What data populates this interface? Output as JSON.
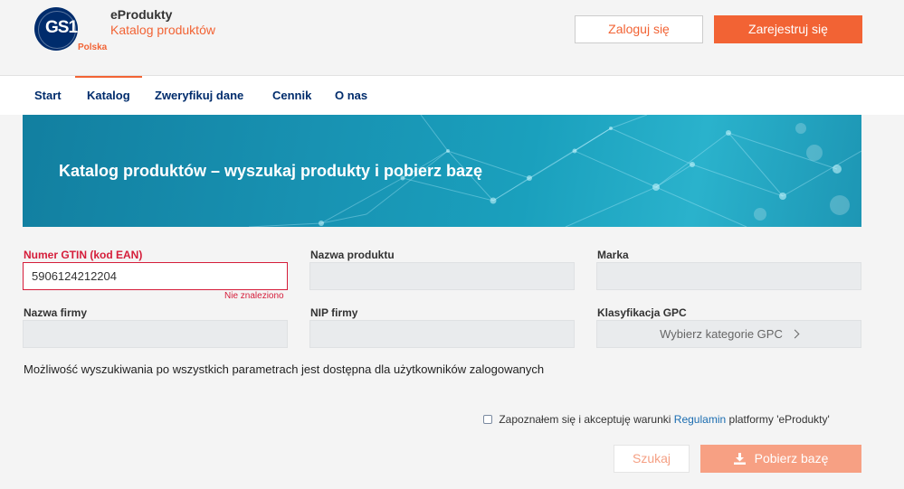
{
  "brand": {
    "logo_text": "GS1",
    "country": "Polska",
    "app_name": "eProdukty",
    "app_subtitle": "Katalog produktów"
  },
  "header": {
    "login_label": "Zaloguj się",
    "register_label": "Zarejestruj się"
  },
  "nav": {
    "items": [
      {
        "label": "Start",
        "active": false
      },
      {
        "label": "Katalog",
        "active": true
      },
      {
        "label": "Zweryfikuj dane",
        "active": false
      },
      {
        "label": "Cennik",
        "active": false
      },
      {
        "label": "O nas",
        "active": false
      }
    ]
  },
  "banner": {
    "title": "Katalog produktów – wyszukaj produkty i pobierz bazę"
  },
  "form": {
    "gtin": {
      "label": "Numer GTIN (kod EAN)",
      "value": "5906124212204",
      "error": "Nie znaleziono"
    },
    "product_name": {
      "label": "Nazwa produktu",
      "value": ""
    },
    "brand": {
      "label": "Marka",
      "value": ""
    },
    "company_name": {
      "label": "Nazwa firmy",
      "value": ""
    },
    "nip": {
      "label": "NIP firmy",
      "value": ""
    },
    "gpc": {
      "label": "Klasyfikacja GPC",
      "button_label": "Wybierz kategorie GPC"
    }
  },
  "info_text": "Możliwość wyszukiwania po wszystkich parametrach jest dostępna dla użytkowników zalogowanych",
  "terms": {
    "checked": false,
    "text_before": "Zapoznałem się i akceptuję warunki",
    "link_label": "Regulamin",
    "text_after": "platformy 'eProdukty'"
  },
  "actions": {
    "search_label": "Szukaj",
    "download_label": "Pobierz bazę"
  },
  "colors": {
    "accent": "#f26334",
    "navy": "#002c6c",
    "error": "#d51d3a",
    "link": "#1a6cb0"
  },
  "icons": {
    "gpc_chevron": "chevron-right-icon",
    "download": "download-icon"
  }
}
